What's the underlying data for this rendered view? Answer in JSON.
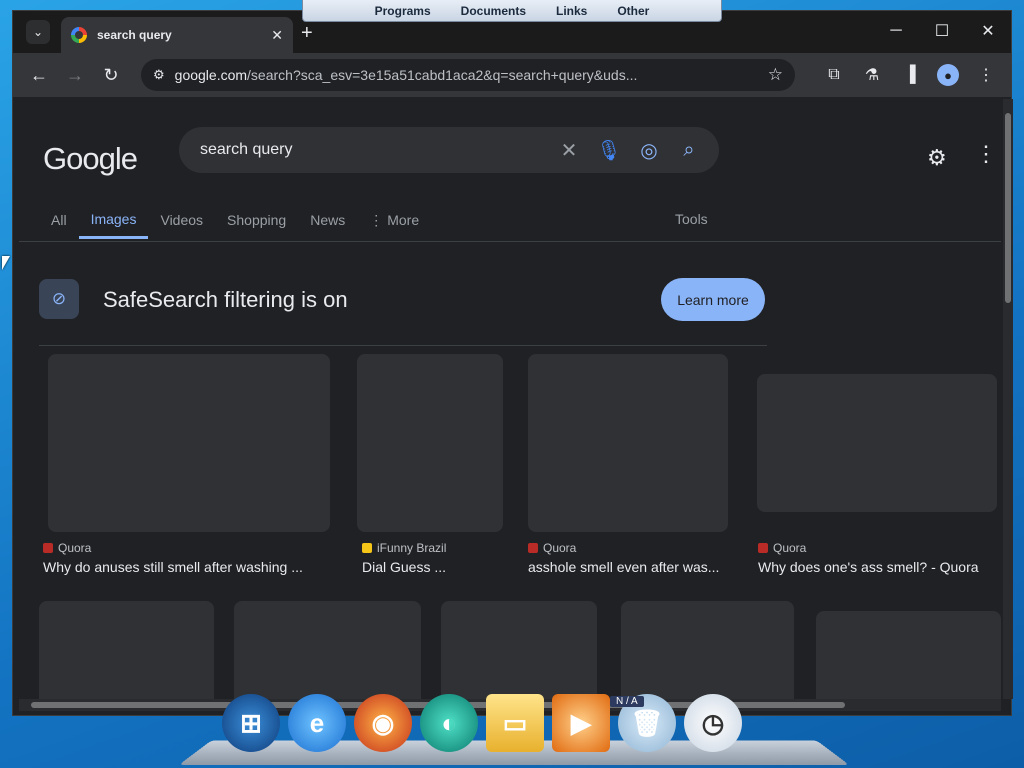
{
  "desktop": {
    "topbar": {
      "items": [
        "Programs",
        "Documents",
        "Links",
        "Other"
      ]
    },
    "na_label": "N / A"
  },
  "browser": {
    "tab": {
      "title": "search query"
    },
    "tab_search_icon": "chevron-down",
    "new_tab_label": "+",
    "window": {
      "minimize": "─",
      "maximize": "☐",
      "close": "✕"
    },
    "toolbar": {
      "url_host": "google.com",
      "url_path": "/search?sca_esv=3e15a51cabd1aca2&q=search+query&uds..."
    }
  },
  "google": {
    "logo": "Google",
    "query": "search query",
    "tabs": [
      {
        "label": "All",
        "active": false
      },
      {
        "label": "Images",
        "active": true
      },
      {
        "label": "Videos",
        "active": false
      },
      {
        "label": "Shopping",
        "active": false
      },
      {
        "label": "News",
        "active": false
      },
      {
        "label": "More",
        "active": false
      }
    ],
    "tools_label": "Tools",
    "safesearch": {
      "text": "SafeSearch filtering is on",
      "button_label": "Learn more"
    },
    "results_row1": [
      {
        "source": "Quora",
        "caption": "Why do anuses still smell after washing ...",
        "source_color": "#b92b27"
      },
      {
        "source": "iFunny Brazil",
        "caption": "Dial Guess ...",
        "source_color": "#f5c518"
      },
      {
        "source": "Quora",
        "caption": "asshole smell even after was...",
        "source_color": "#b92b27"
      },
      {
        "source": "Quora",
        "caption": "Why does one's ass smell? - Quora",
        "source_color": "#b92b27"
      }
    ]
  },
  "colors": {
    "accent": "#8ab4f8",
    "page_bg": "#202124",
    "text": "#e8eaed"
  }
}
